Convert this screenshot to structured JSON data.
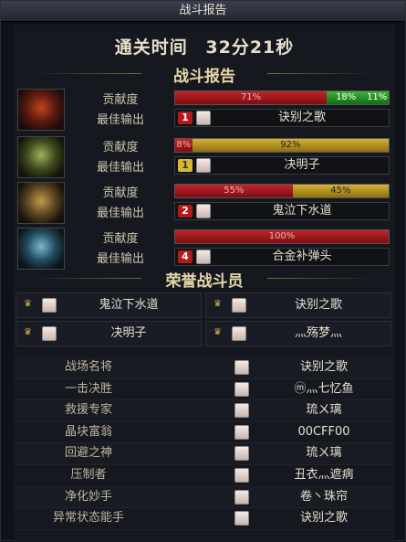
{
  "window": {
    "title": "战斗报告"
  },
  "clear_time": {
    "label": "通关时间",
    "value": "32分21秒"
  },
  "battle_section_title": "战斗报告",
  "teams": [
    {
      "contribution_label": "贡献度",
      "best_label": "最佳输出",
      "segments": [
        {
          "text": "71%",
          "pct": 71,
          "color": "red"
        },
        {
          "text": "18%",
          "pct": 18,
          "color": "green"
        },
        {
          "text": "11%",
          "pct": 11,
          "color": "green"
        }
      ],
      "rank": "1",
      "rank_color": "red",
      "best_name": "诀别之歌"
    },
    {
      "contribution_label": "贡献度",
      "best_label": "最佳输出",
      "segments": [
        {
          "text": "8%",
          "pct": 8,
          "color": "red"
        },
        {
          "text": "92%",
          "pct": 92,
          "color": "gold"
        }
      ],
      "rank": "1",
      "rank_color": "gold",
      "best_name": "决明子"
    },
    {
      "contribution_label": "贡献度",
      "best_label": "最佳输出",
      "segments": [
        {
          "text": "55%",
          "pct": 55,
          "color": "red"
        },
        {
          "text": "45%",
          "pct": 45,
          "color": "gold"
        }
      ],
      "rank": "2",
      "rank_color": "red",
      "best_name": "鬼泣下水道"
    },
    {
      "contribution_label": "贡献度",
      "best_label": "最佳输出",
      "segments": [
        {
          "text": "100%",
          "pct": 100,
          "color": "red"
        }
      ],
      "rank": "4",
      "rank_color": "red",
      "best_name": "合金补弹头"
    }
  ],
  "honor_section_title": "荣誉战斗员",
  "honor_members": [
    "鬼泣下水道",
    "诀别之歌",
    "决明子",
    "灬殇梦灬"
  ],
  "awards": [
    {
      "title": "战场名将",
      "name": "诀别之歌"
    },
    {
      "title": "一击决胜",
      "name": "ⓜ灬七忆鱼"
    },
    {
      "title": "救援专家",
      "name": "琉ㄨ璃"
    },
    {
      "title": "晶块富翁",
      "name": "00CFF00"
    },
    {
      "title": "回避之神",
      "name": "琉ㄨ璃"
    },
    {
      "title": "压制者",
      "name": "丑衣灬遮病"
    },
    {
      "title": "净化妙手",
      "name": "卷丶珠帘"
    },
    {
      "title": "异常状态能手",
      "name": "诀别之歌"
    }
  ]
}
